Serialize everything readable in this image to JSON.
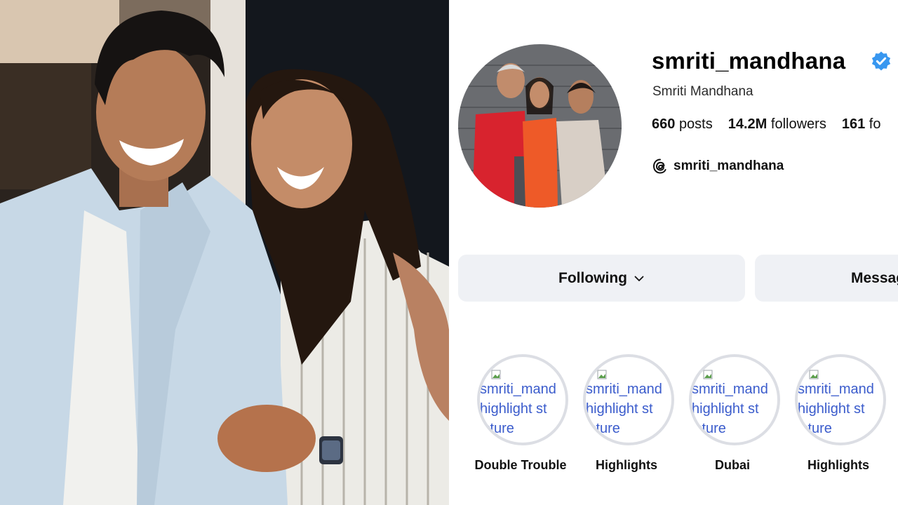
{
  "profile": {
    "username": "smriti_mandhana",
    "full_name": "Smriti Mandhana",
    "verified": true,
    "stats": [
      {
        "value": "660",
        "label": "posts"
      },
      {
        "value": "14.2M",
        "label": "followers"
      },
      {
        "value": "161",
        "label": "fo"
      }
    ],
    "threads_handle": "smriti_mandhana"
  },
  "buttons": {
    "following": "Following",
    "message": "Messag"
  },
  "highlights": [
    {
      "alt_lines": [
        "smriti_mand",
        "highlight st",
        "icture"
      ],
      "label": "Double Trouble"
    },
    {
      "alt_lines": [
        "smriti_mand",
        "highlight st",
        "icture"
      ],
      "label": "Highlights"
    },
    {
      "alt_lines": [
        "smriti_mand",
        "highlight st",
        "icture"
      ],
      "label": "Dubai"
    },
    {
      "alt_lines": [
        "smriti_mand",
        "highlight st",
        "icture"
      ],
      "label": "Highlights"
    }
  ],
  "icons": {
    "verified": "verified-badge-icon",
    "threads": "threads-icon",
    "chevron": "chevron-down-icon",
    "broken_image": "broken-image-icon"
  },
  "colors": {
    "verified_blue": "#3897f0",
    "button_bg": "#eff1f5",
    "alt_text_blue": "#3b5ccc",
    "highlight_ring": "#dcdee4"
  }
}
